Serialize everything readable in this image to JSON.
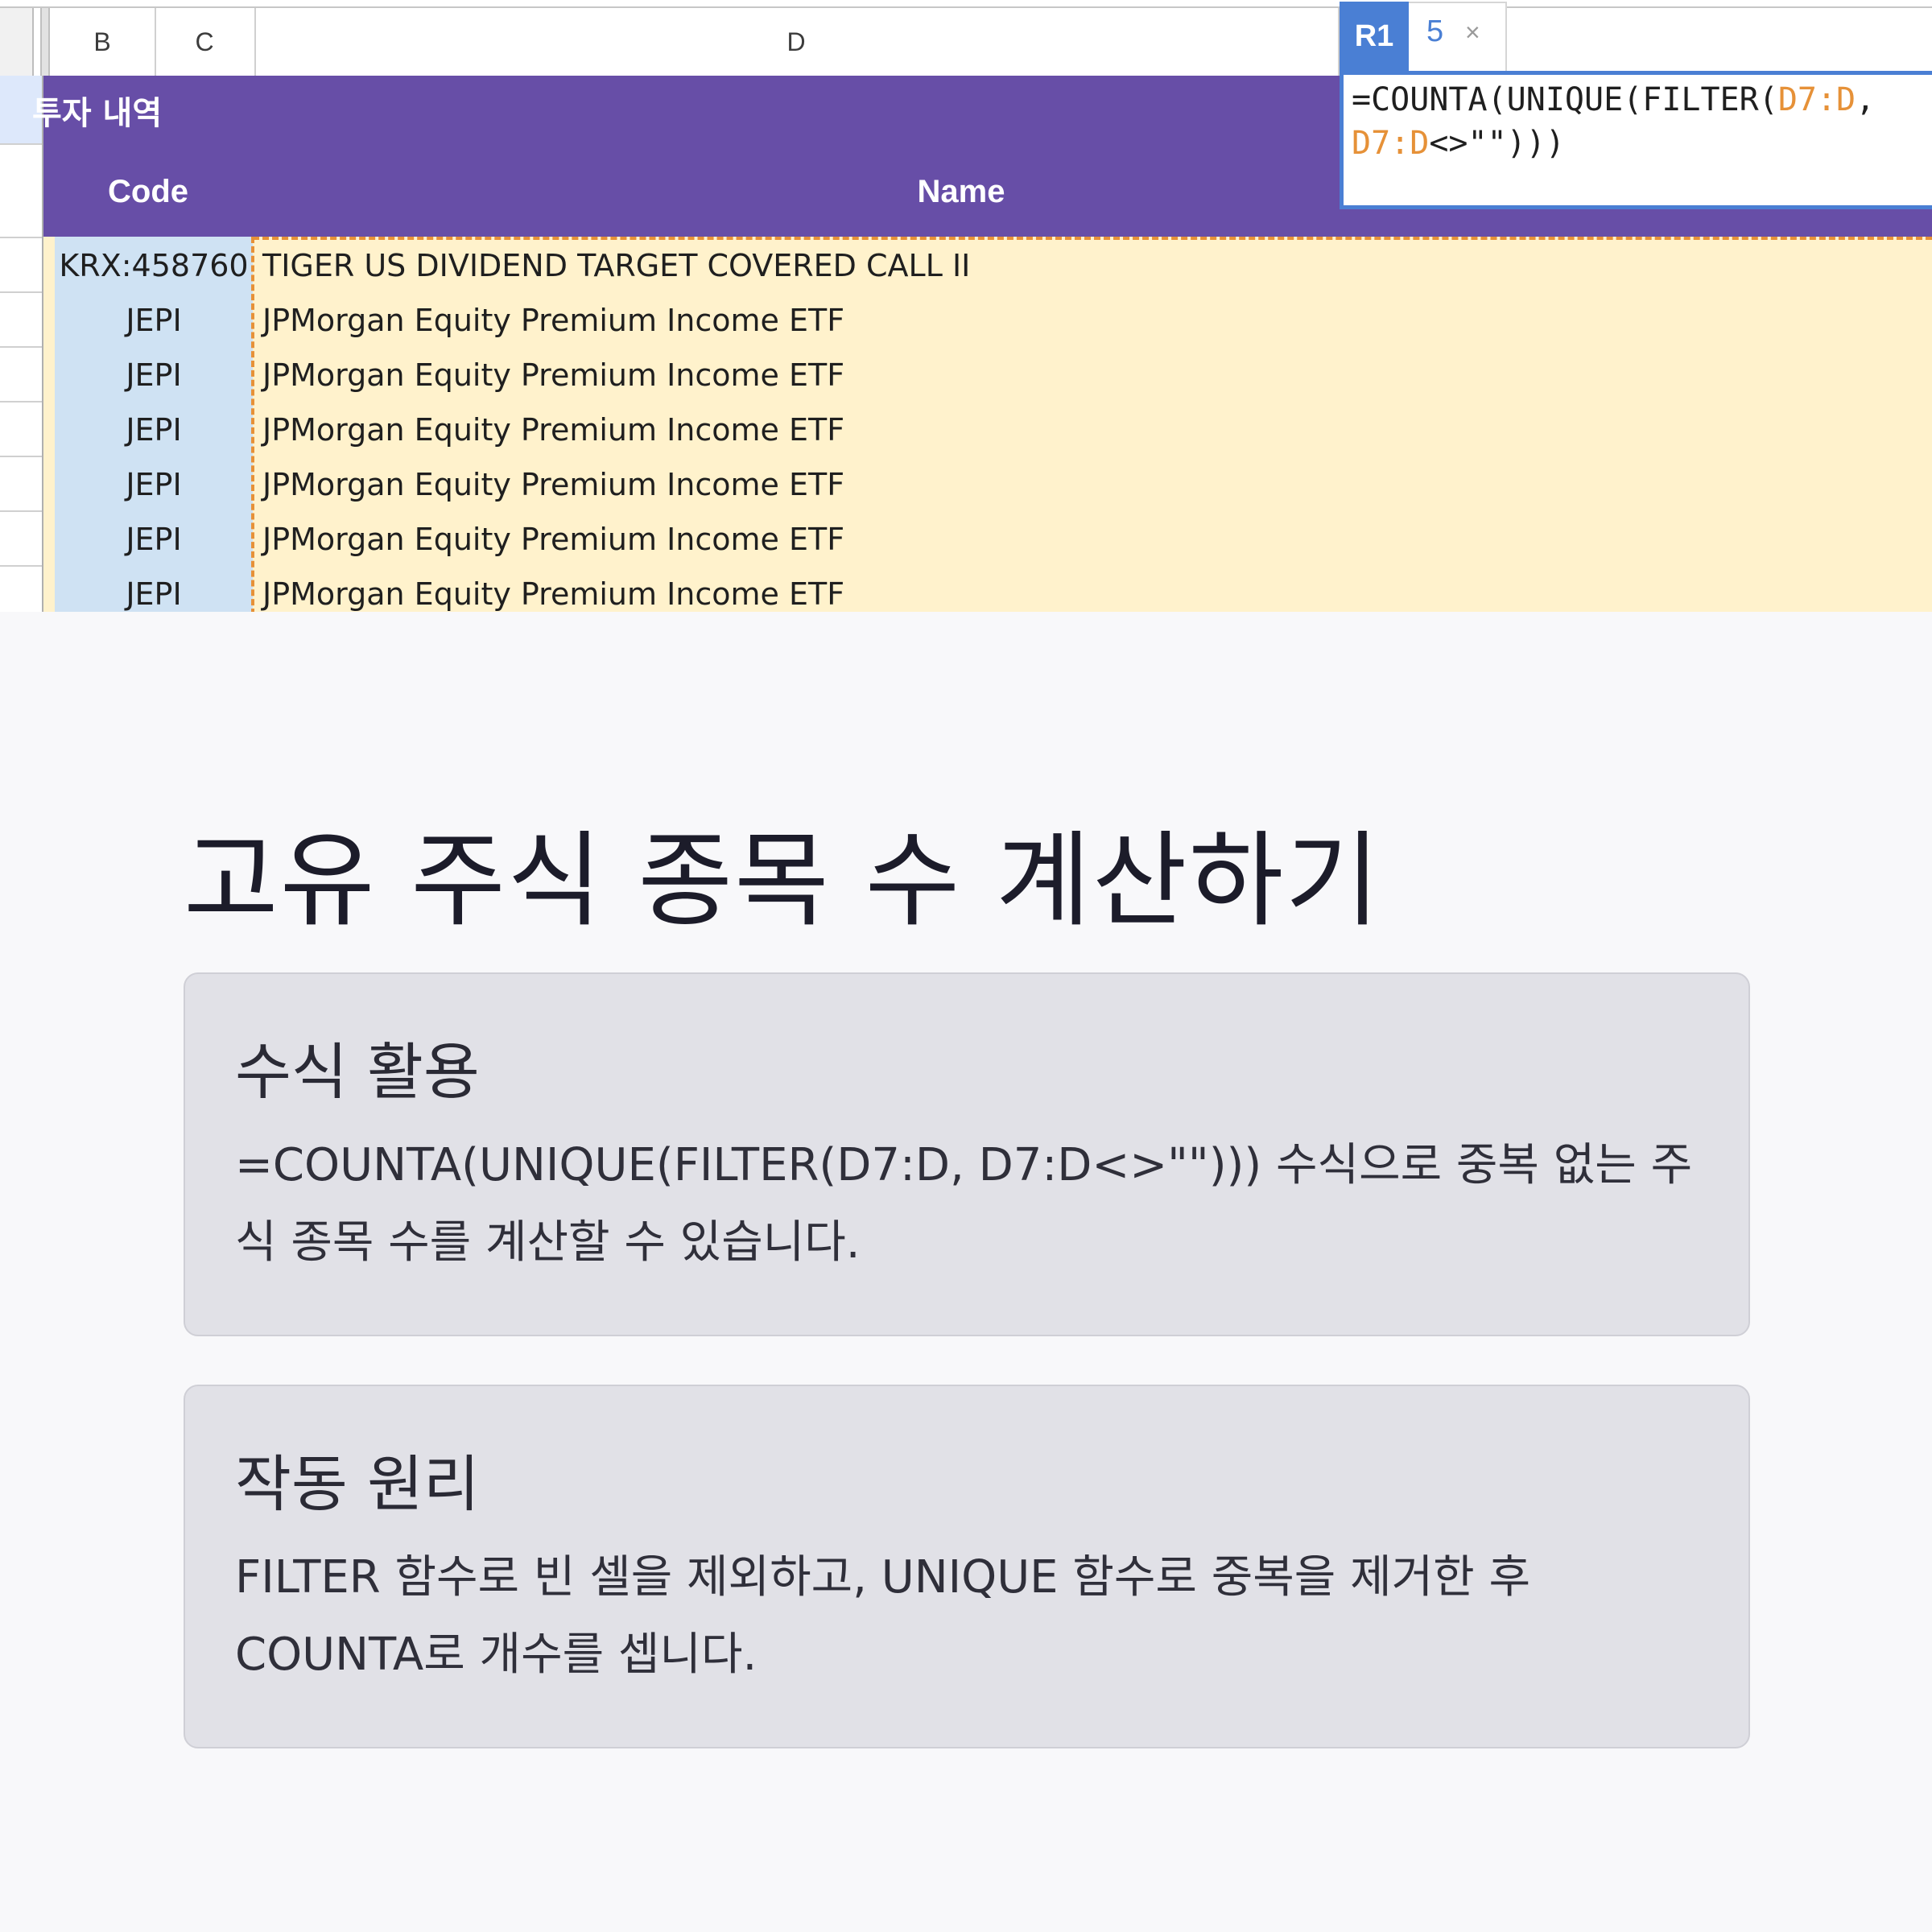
{
  "spreadsheet": {
    "column_headers": [
      "B",
      "C",
      "D"
    ],
    "sheet_title": "투자 내역",
    "table_headers": {
      "code": "Code",
      "name": "Name"
    },
    "rows": [
      {
        "code": "KRX:458760",
        "name": "TIGER US DIVIDEND TARGET COVERED CALL II"
      },
      {
        "code": "JEPI",
        "name": "JPMorgan Equity Premium Income ETF"
      },
      {
        "code": "JEPI",
        "name": "JPMorgan Equity Premium Income ETF"
      },
      {
        "code": "JEPI",
        "name": "JPMorgan Equity Premium Income ETF"
      },
      {
        "code": "JEPI",
        "name": "JPMorgan Equity Premium Income ETF"
      },
      {
        "code": "JEPI",
        "name": "JPMorgan Equity Premium Income ETF"
      },
      {
        "code": "JEPI",
        "name": "JPMorgan Equity Premium Income ETF"
      }
    ],
    "formula_popup": {
      "cell_ref": "R1",
      "result_value": "5",
      "close_symbol": "×",
      "formula_line1_a": "=COUNTA(UNIQUE(FILTER(",
      "formula_line1_ref": "D7:D",
      "formula_line1_b": ",",
      "formula_line2_ref": "D7:D",
      "formula_line2_b": "<>\"\")))"
    },
    "colors": {
      "header_purple": "#674ea7",
      "code_column_blue": "#cfe2f3",
      "name_column_yellow": "#fff2cc",
      "selection_dash_orange": "#e69138",
      "formula_accent_blue": "#4a7fd4"
    }
  },
  "content": {
    "title": "고유 주식 종목 수 계산하기",
    "cards": [
      {
        "heading": "수식 활용",
        "body": "=COUNTA(UNIQUE(FILTER(D7:D, D7:D<>\"\"))) 수식으로 중복 없는 주식 종목 수를 계산할 수 있습니다."
      },
      {
        "heading": "작동 원리",
        "body": "FILTER 함수로 빈 셀을 제외하고, UNIQUE 함수로 중복을 제거한 후 COUNTA로 개수를 셉니다."
      }
    ]
  }
}
